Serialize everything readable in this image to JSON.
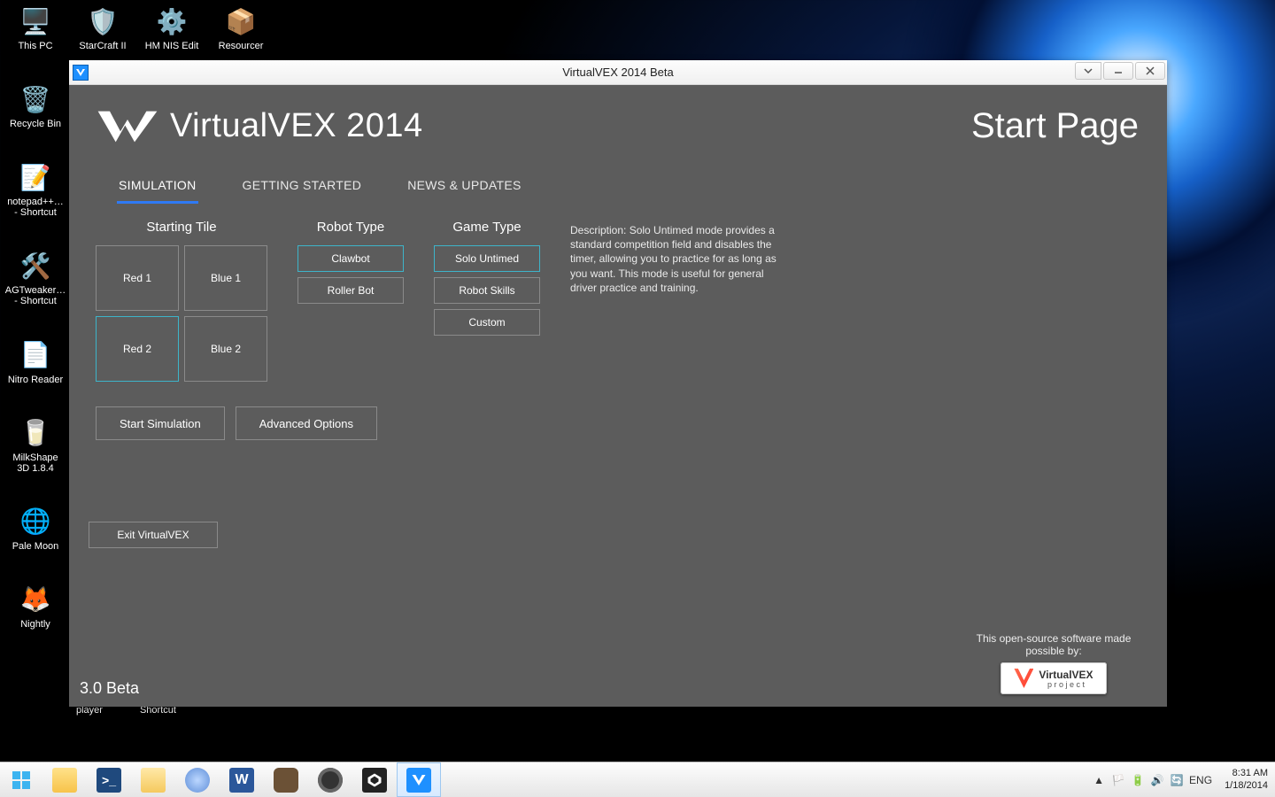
{
  "desktop": {
    "icons": [
      {
        "name": "this-pc",
        "label": "This PC",
        "glyph": "🖥️"
      },
      {
        "name": "recycle-bin",
        "label": "Recycle Bin",
        "glyph": "🗑️"
      },
      {
        "name": "notepadpp",
        "label": "notepad++…\n- Shortcut",
        "glyph": "📝"
      },
      {
        "name": "agtweaker",
        "label": "AGTweaker…\n- Shortcut",
        "glyph": "🛠️"
      },
      {
        "name": "nitro-reader",
        "label": "Nitro Reader",
        "glyph": "📄"
      },
      {
        "name": "milkshape",
        "label": "MilkShape\n3D 1.8.4",
        "glyph": "🥛"
      },
      {
        "name": "palemoon",
        "label": "Pale Moon",
        "glyph": "🌐"
      },
      {
        "name": "nightly",
        "label": "Nightly",
        "glyph": "🦊"
      }
    ],
    "toprow": [
      {
        "name": "starcraft",
        "label": "StarCraft II",
        "glyph": "🛡️"
      },
      {
        "name": "hmnis",
        "label": "HM NIS Edit",
        "glyph": "⚙️"
      },
      {
        "name": "resourcer",
        "label": "Resourcer",
        "glyph": "📦"
      }
    ],
    "bottom_fragments": [
      "player",
      "Shortcut"
    ]
  },
  "window": {
    "title": "VirtualVEX 2014 Beta",
    "brand": "VirtualVEX 2014",
    "page_title": "Start Page",
    "tabs": [
      {
        "id": "simulation",
        "label": "SIMULATION",
        "active": true
      },
      {
        "id": "getting-started",
        "label": "GETTING STARTED",
        "active": false
      },
      {
        "id": "news",
        "label": "NEWS & UPDATES",
        "active": false
      }
    ],
    "columns": {
      "starting_tile": {
        "heading": "Starting Tile",
        "tiles": [
          {
            "id": "red1",
            "label": "Red 1",
            "selected": false
          },
          {
            "id": "blue1",
            "label": "Blue 1",
            "selected": false
          },
          {
            "id": "red2",
            "label": "Red 2",
            "selected": true
          },
          {
            "id": "blue2",
            "label": "Blue 2",
            "selected": false
          }
        ]
      },
      "robot_type": {
        "heading": "Robot Type",
        "options": [
          {
            "id": "clawbot",
            "label": "Clawbot",
            "selected": true
          },
          {
            "id": "rollerbot",
            "label": "Roller Bot",
            "selected": false
          }
        ]
      },
      "game_type": {
        "heading": "Game Type",
        "options": [
          {
            "id": "solo",
            "label": "Solo Untimed",
            "selected": true
          },
          {
            "id": "skills",
            "label": "Robot Skills",
            "selected": false
          },
          {
            "id": "custom",
            "label": "Custom",
            "selected": false
          }
        ]
      },
      "description": "Description: Solo Untimed mode provides a standard competition field and disables the timer, allowing you to practice for as long as you want. This mode is useful for general driver practice and training."
    },
    "actions": {
      "start": "Start Simulation",
      "advanced": "Advanced Options",
      "exit": "Exit VirtualVEX"
    },
    "version": "3.0 Beta",
    "credit": {
      "text": "This open-source software made possible by:",
      "logo_main": "VirtualVEX",
      "logo_sub": "p r o j e c t"
    }
  },
  "taskbar": {
    "lang": "ENG",
    "time": "8:31 AM",
    "date": "1/18/2014"
  }
}
